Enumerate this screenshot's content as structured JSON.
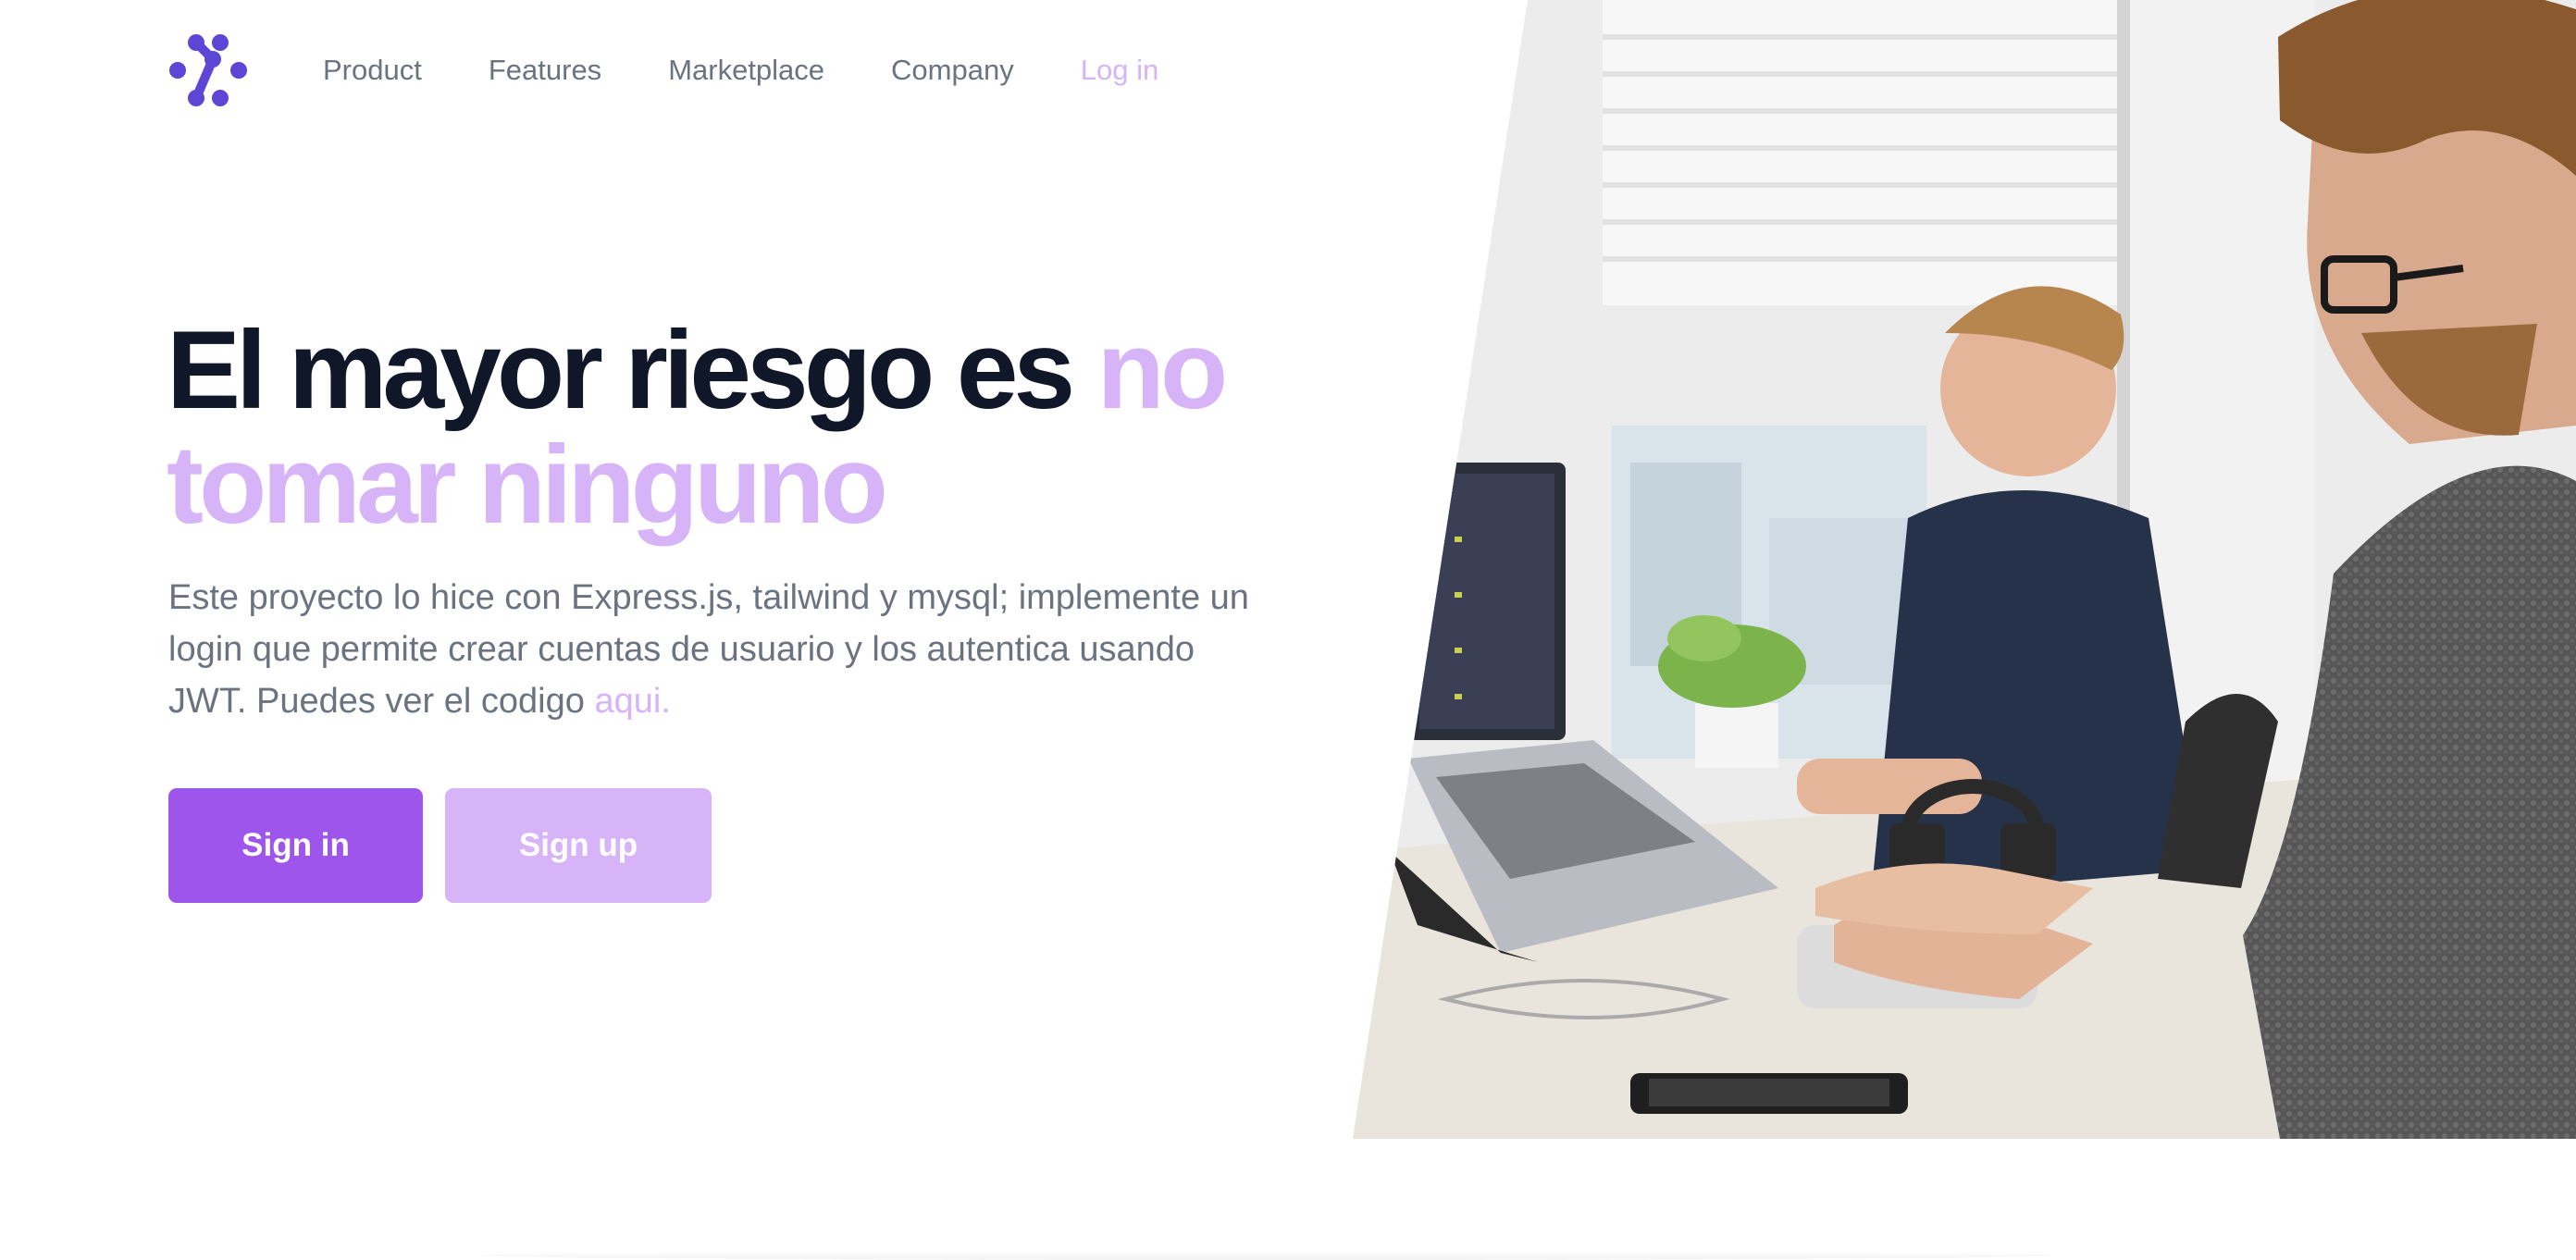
{
  "brand": {
    "logo_icon": "tailwind-ui-dots-logo",
    "accent_color": "#9d55ec",
    "accent_light": "#d6b4f7"
  },
  "nav": {
    "items": [
      {
        "label": "Product"
      },
      {
        "label": "Features"
      },
      {
        "label": "Marketplace"
      },
      {
        "label": "Company"
      }
    ],
    "login_label": "Log in"
  },
  "hero": {
    "headline_main": "El mayor riesgo es",
    "headline_accent_1": "no",
    "headline_accent_2": "tomar ninguno",
    "description": "Este proyecto lo hice con Express.js, tailwind y mysql; implemente un login que permite crear cuentas de usuario y los autentica usando JWT. Puedes ver el codigo",
    "description_link": "aqui.",
    "signin_label": "Sign in",
    "signup_label": "Sign up"
  }
}
